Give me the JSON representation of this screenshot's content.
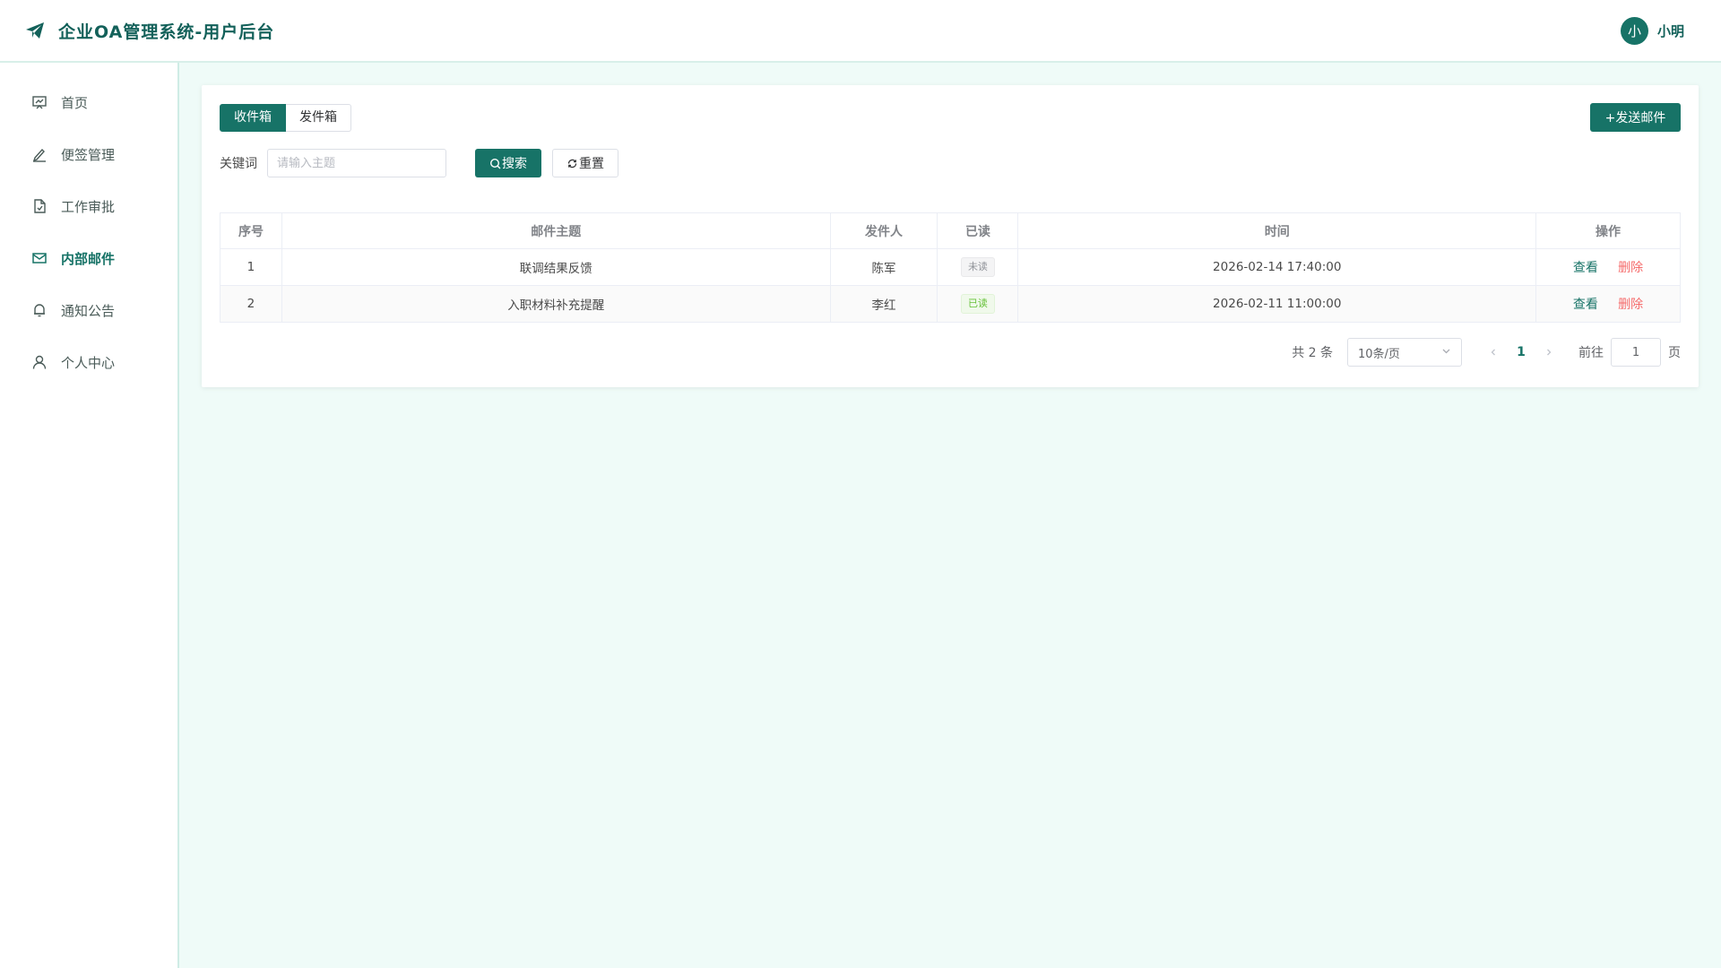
{
  "header": {
    "title": "企业OA管理系统-用户后台",
    "user": {
      "avatar_text": "小",
      "name": "小明"
    }
  },
  "sidebar": {
    "items": [
      {
        "label": "首页",
        "icon": "dashboard-icon",
        "active": false
      },
      {
        "label": "便签管理",
        "icon": "edit-pen-icon",
        "active": false
      },
      {
        "label": "工作审批",
        "icon": "document-check-icon",
        "active": false
      },
      {
        "label": "内部邮件",
        "icon": "mail-icon",
        "active": true
      },
      {
        "label": "通知公告",
        "icon": "bell-icon",
        "active": false
      },
      {
        "label": "个人中心",
        "icon": "user-icon",
        "active": false
      }
    ]
  },
  "mailbox": {
    "tabs": [
      {
        "label": "收件箱",
        "active": true
      },
      {
        "label": "发件箱",
        "active": false
      }
    ],
    "send_label": "+发送邮件",
    "filter": {
      "keyword_label": "关键词",
      "keyword_placeholder": "请输入主题",
      "keyword_value": "",
      "search_label": "搜索",
      "reset_label": "重置"
    },
    "table": {
      "columns": [
        "序号",
        "邮件主题",
        "发件人",
        "已读",
        "时间",
        "操作"
      ],
      "rows": [
        {
          "index": "1",
          "subject": "联调结果反馈",
          "sender": "陈军",
          "read_status": "未读",
          "read": false,
          "time": "2026-02-14 17:40:00"
        },
        {
          "index": "2",
          "subject": "入职材料补充提醒",
          "sender": "李红",
          "read_status": "已读",
          "read": true,
          "time": "2026-02-11 11:00:00"
        }
      ],
      "actions": {
        "view": "查看",
        "delete": "删除"
      }
    },
    "pagination": {
      "total_text": "共 2 条",
      "page_size": "10条/页",
      "current_page": "1",
      "goto_label": "前往",
      "goto_value": "1",
      "goto_suffix": "页"
    }
  },
  "colors": {
    "primary": "#177367",
    "background": "#effbf8",
    "danger": "#f56c6c",
    "success": "#67c23a"
  }
}
